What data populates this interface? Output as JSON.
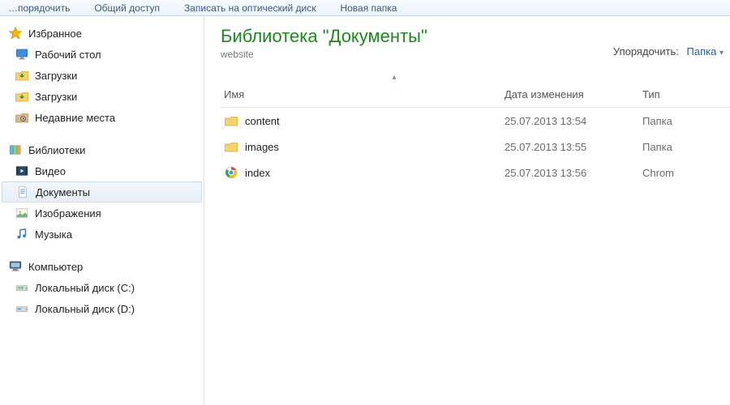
{
  "toolbar": {
    "items": [
      "…порядочить",
      "Общий доступ",
      "Записать на оптический диск",
      "Новая папка"
    ]
  },
  "sidebar": {
    "favorites": {
      "label": "Избранное",
      "items": [
        {
          "label": "Рабочий стол",
          "icon": "desktop-icon"
        },
        {
          "label": "Загрузки",
          "icon": "downloads-icon"
        },
        {
          "label": "Загрузки",
          "icon": "downloads-icon"
        },
        {
          "label": "Недавние места",
          "icon": "recent-icon"
        }
      ]
    },
    "libraries": {
      "label": "Библиотеки",
      "items": [
        {
          "label": "Видео",
          "icon": "video-icon"
        },
        {
          "label": "Документы",
          "icon": "documents-icon",
          "selected": true
        },
        {
          "label": "Изображения",
          "icon": "images-icon"
        },
        {
          "label": "Музыка",
          "icon": "music-icon"
        }
      ]
    },
    "computer": {
      "label": "Компьютер",
      "items": [
        {
          "label": "Локальный диск (C:)",
          "icon": "drive-icon"
        },
        {
          "label": "Локальный диск (D:)",
          "icon": "drive-icon"
        }
      ]
    }
  },
  "main": {
    "title": "Библиотека \"Документы\"",
    "subtitle": "website",
    "arrange_label": "Упорядочить:",
    "arrange_value": "Папка",
    "columns": {
      "name": "Имя",
      "date": "Дата изменения",
      "type": "Тип"
    },
    "rows": [
      {
        "name": "content",
        "date": "25.07.2013 13:54",
        "type": "Папка",
        "icon": "folder-icon"
      },
      {
        "name": "images",
        "date": "25.07.2013 13:55",
        "type": "Папка",
        "icon": "folder-icon"
      },
      {
        "name": "index",
        "date": "25.07.2013 13:56",
        "type": "Chrom",
        "icon": "chrome-icon"
      }
    ]
  }
}
